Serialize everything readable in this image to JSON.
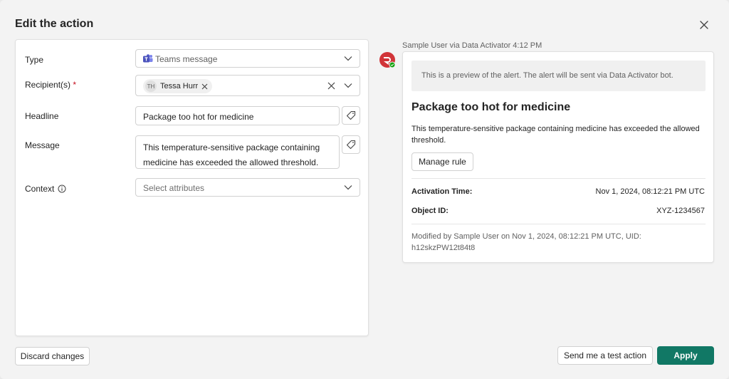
{
  "dialog": {
    "title": "Edit the action",
    "close_icon": "close-icon"
  },
  "form": {
    "type": {
      "label": "Type",
      "value": "Teams message",
      "icon": "teams-icon"
    },
    "recipients": {
      "label": "Recipient(s)",
      "required_marker": "*",
      "chip_initials": "TH",
      "chip_name": "Tessa Hurr"
    },
    "headline": {
      "label": "Headline",
      "value": "Package too hot for medicine"
    },
    "message": {
      "label": "Message",
      "line1": "This temperature-sensitive package containing",
      "line2": "medicine has exceeded the allowed threshold."
    },
    "context": {
      "label": "Context",
      "placeholder": "Select attributes"
    }
  },
  "preview": {
    "sender": "Sample User via Data Activator  4:12 PM",
    "notice": "This is a preview of the alert. The alert will be sent via Data Activator bot.",
    "headline": "Package too hot for medicine",
    "message": "This temperature-sensitive package containing medicine has exceeded the allowed threshold.",
    "manage_rule_label": "Manage rule",
    "activation_time_label": "Activation Time:",
    "activation_time_value": "Nov 1, 2024, 08:12:21 PM UTC",
    "object_id_label": "Object ID:",
    "object_id_value": "XYZ-1234567",
    "modified_line1": "Modified by Sample User on Nov 1, 2024, 08:12:21 PM UTC, UID:",
    "modified_line2": "h12skzPW12t84t8"
  },
  "footer": {
    "discard_label": "Discard changes",
    "test_label": "Send me a test action",
    "apply_label": "Apply"
  },
  "colors": {
    "primary": "#117865",
    "required": "#c50f1f",
    "bot_red": "#d13438",
    "status_green": "#13a10e"
  }
}
